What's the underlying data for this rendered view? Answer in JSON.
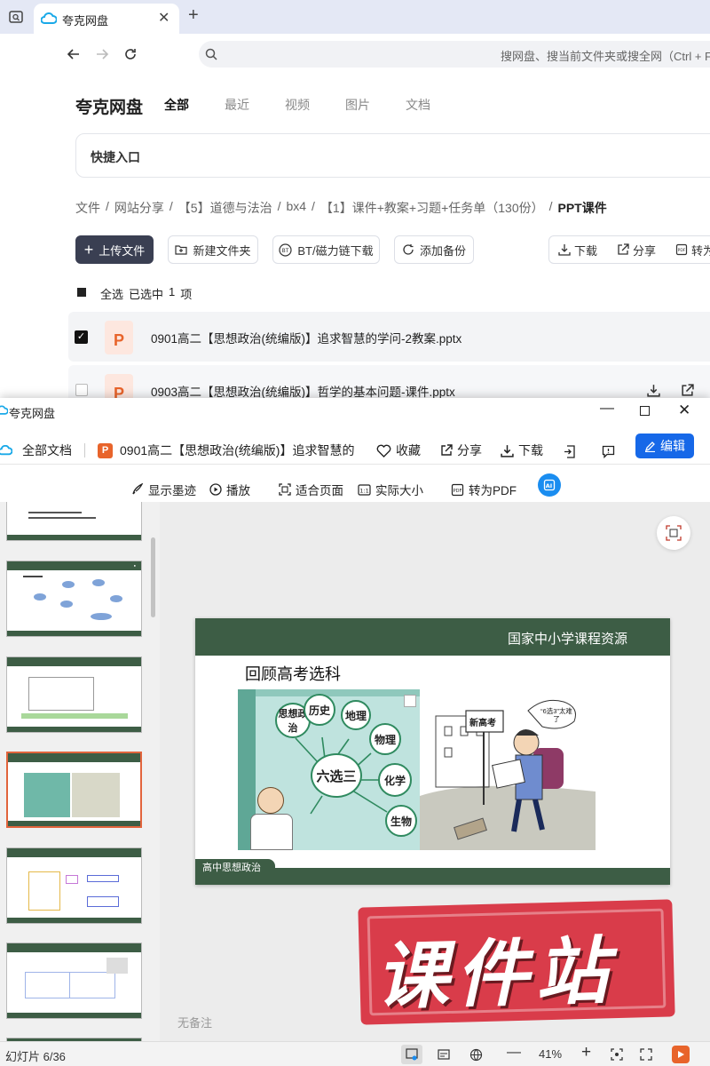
{
  "browser": {
    "tab_title": "夸克网盘",
    "search_placeholder": "搜网盘、搜当前文件夹或搜全网（Ctrl + F）"
  },
  "drive": {
    "logo": "夸克网盘",
    "nav": [
      "全部",
      "最近",
      "视频",
      "图片",
      "文档"
    ],
    "quick_entry": "快捷入口",
    "breadcrumb": [
      "文件",
      "网站分享",
      "【5】道德与法治",
      "bx4",
      "【1】课件+教案+习题+任务单（130份）",
      "PPT课件"
    ],
    "toolbar": {
      "upload": "上传文件",
      "new_folder": "新建文件夹",
      "bt": "BT/磁力链下载",
      "backup": "添加备份",
      "download": "下载",
      "share": "分享",
      "convert": "转为"
    },
    "select_all": "全选",
    "selected_prefix": "已选中",
    "selected_count": "1",
    "selected_unit": "项",
    "files": [
      {
        "name": "0901高二【思想政治(统编版)】追求智慧的学问-2教案.pptx",
        "checked": true
      },
      {
        "name": "0903高二【思想政治(统编版)】哲学的基本问题-课件.pptx",
        "checked": false
      }
    ]
  },
  "viewer": {
    "title": "夸克网盘",
    "all_docs": "全部文档",
    "doc_title": "0901高二【思想政治(统编版)】追求智慧的",
    "actions": {
      "favorite": "收藏",
      "share": "分享",
      "download": "下载",
      "edit": "编辑"
    },
    "tools": {
      "ink": "显示墨迹",
      "play": "播放",
      "fit": "适合页面",
      "actual": "实际大小",
      "pdf": "转为PDF"
    },
    "no_notes": "无备注",
    "slide_counter": "幻灯片 6/36",
    "zoom": "41%",
    "slide": {
      "header": "国家中小学课程资源",
      "title": "回顾高考选科",
      "center": "六选三",
      "subjects": [
        "思想政治",
        "历史",
        "地理",
        "物理",
        "化学",
        "生物"
      ],
      "sign": "新高考",
      "speech": "“6选3”太难了",
      "footer": "高中思想政治"
    },
    "watermark": "课件站"
  }
}
